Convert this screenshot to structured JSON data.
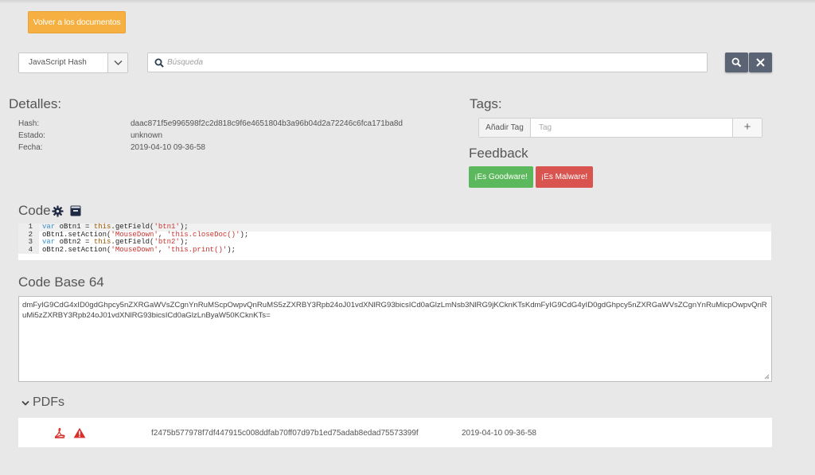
{
  "toolbar": {
    "back_label": "Volver a los documentos",
    "select_value": "JavaScript Hash",
    "search_placeholder": "Búsqueda"
  },
  "details": {
    "title": "Detalles:",
    "rows": [
      {
        "key": "Hash:",
        "value": "daac871f5e996598f2c2d818c9f6e4651804b3a96b04d2a72246c6fca171ba8d"
      },
      {
        "key": "Estado:",
        "value": "unknown"
      },
      {
        "key": "Fecha:",
        "value": "2019-04-10 09-36-58"
      }
    ]
  },
  "tags": {
    "title": "Tags:",
    "add_label": "Añadir Tag",
    "input_placeholder": "Tag",
    "plus_label": "+"
  },
  "feedback": {
    "title": "Feedback",
    "goodware_label": "¡Es Goodware!",
    "malware_label": "¡Es Malware!",
    "goodware_color": "#5cb85c",
    "malware_color": "#d9534f"
  },
  "code": {
    "title": "Code",
    "lines": [
      {
        "n": "1",
        "parts": [
          [
            "kw",
            "var"
          ],
          [
            "t",
            " oBtn1 = "
          ],
          [
            "th",
            "this"
          ],
          [
            "t",
            ".getField("
          ],
          [
            "str",
            "'btn1'"
          ],
          [
            "t",
            ");"
          ]
        ]
      },
      {
        "n": "2",
        "parts": [
          [
            "t",
            "oBtn1.setAction("
          ],
          [
            "str",
            "'MouseDown'"
          ],
          [
            "t",
            ", "
          ],
          [
            "str",
            "'this.closeDoc()'"
          ],
          [
            "t",
            ");"
          ]
        ]
      },
      {
        "n": "3",
        "parts": [
          [
            "kw",
            "var"
          ],
          [
            "t",
            " oBtn2 = "
          ],
          [
            "th",
            "this"
          ],
          [
            "t",
            ".getField("
          ],
          [
            "str",
            "'btn2'"
          ],
          [
            "t",
            ");"
          ]
        ]
      },
      {
        "n": "4",
        "parts": [
          [
            "t",
            "oBtn2.setAction("
          ],
          [
            "str",
            "'MouseDown'"
          ],
          [
            "t",
            ", "
          ],
          [
            "str",
            "'this.print()'"
          ],
          [
            "t",
            ");"
          ]
        ]
      }
    ]
  },
  "code_b64": {
    "title": "Code Base 64",
    "value": "dmFyIG9CdG4xID0gdGhpcy5nZXRGaWVsZCgnYnRuMScpOwpvQnRuMS5zZXRBY3Rpb24oJ01vdXNlRG93bicsICd0aGlzLmNsb3NlRG9jKCknKTsKdmFyIG9CdG4yID0gdGhpcy5nZXRGaWVsZCgnYnRuMicpOwpvQnRuMi5zZXRBY3Rpb24oJ01vdXNlRG93bicsICd0aGlzLnByaW50KCknKTs="
  },
  "pdfs": {
    "title": "PDFs",
    "rows": [
      {
        "hash": "f2475b577978f7df447915c008ddfab70ff07d97b1ed75adab8edad75573399f",
        "date": "2019-04-10 09-36-58"
      }
    ]
  },
  "colors": {
    "accent_orange": "#f5b041",
    "dark_button": "#5b6474",
    "pdf_red": "#d9302c"
  }
}
